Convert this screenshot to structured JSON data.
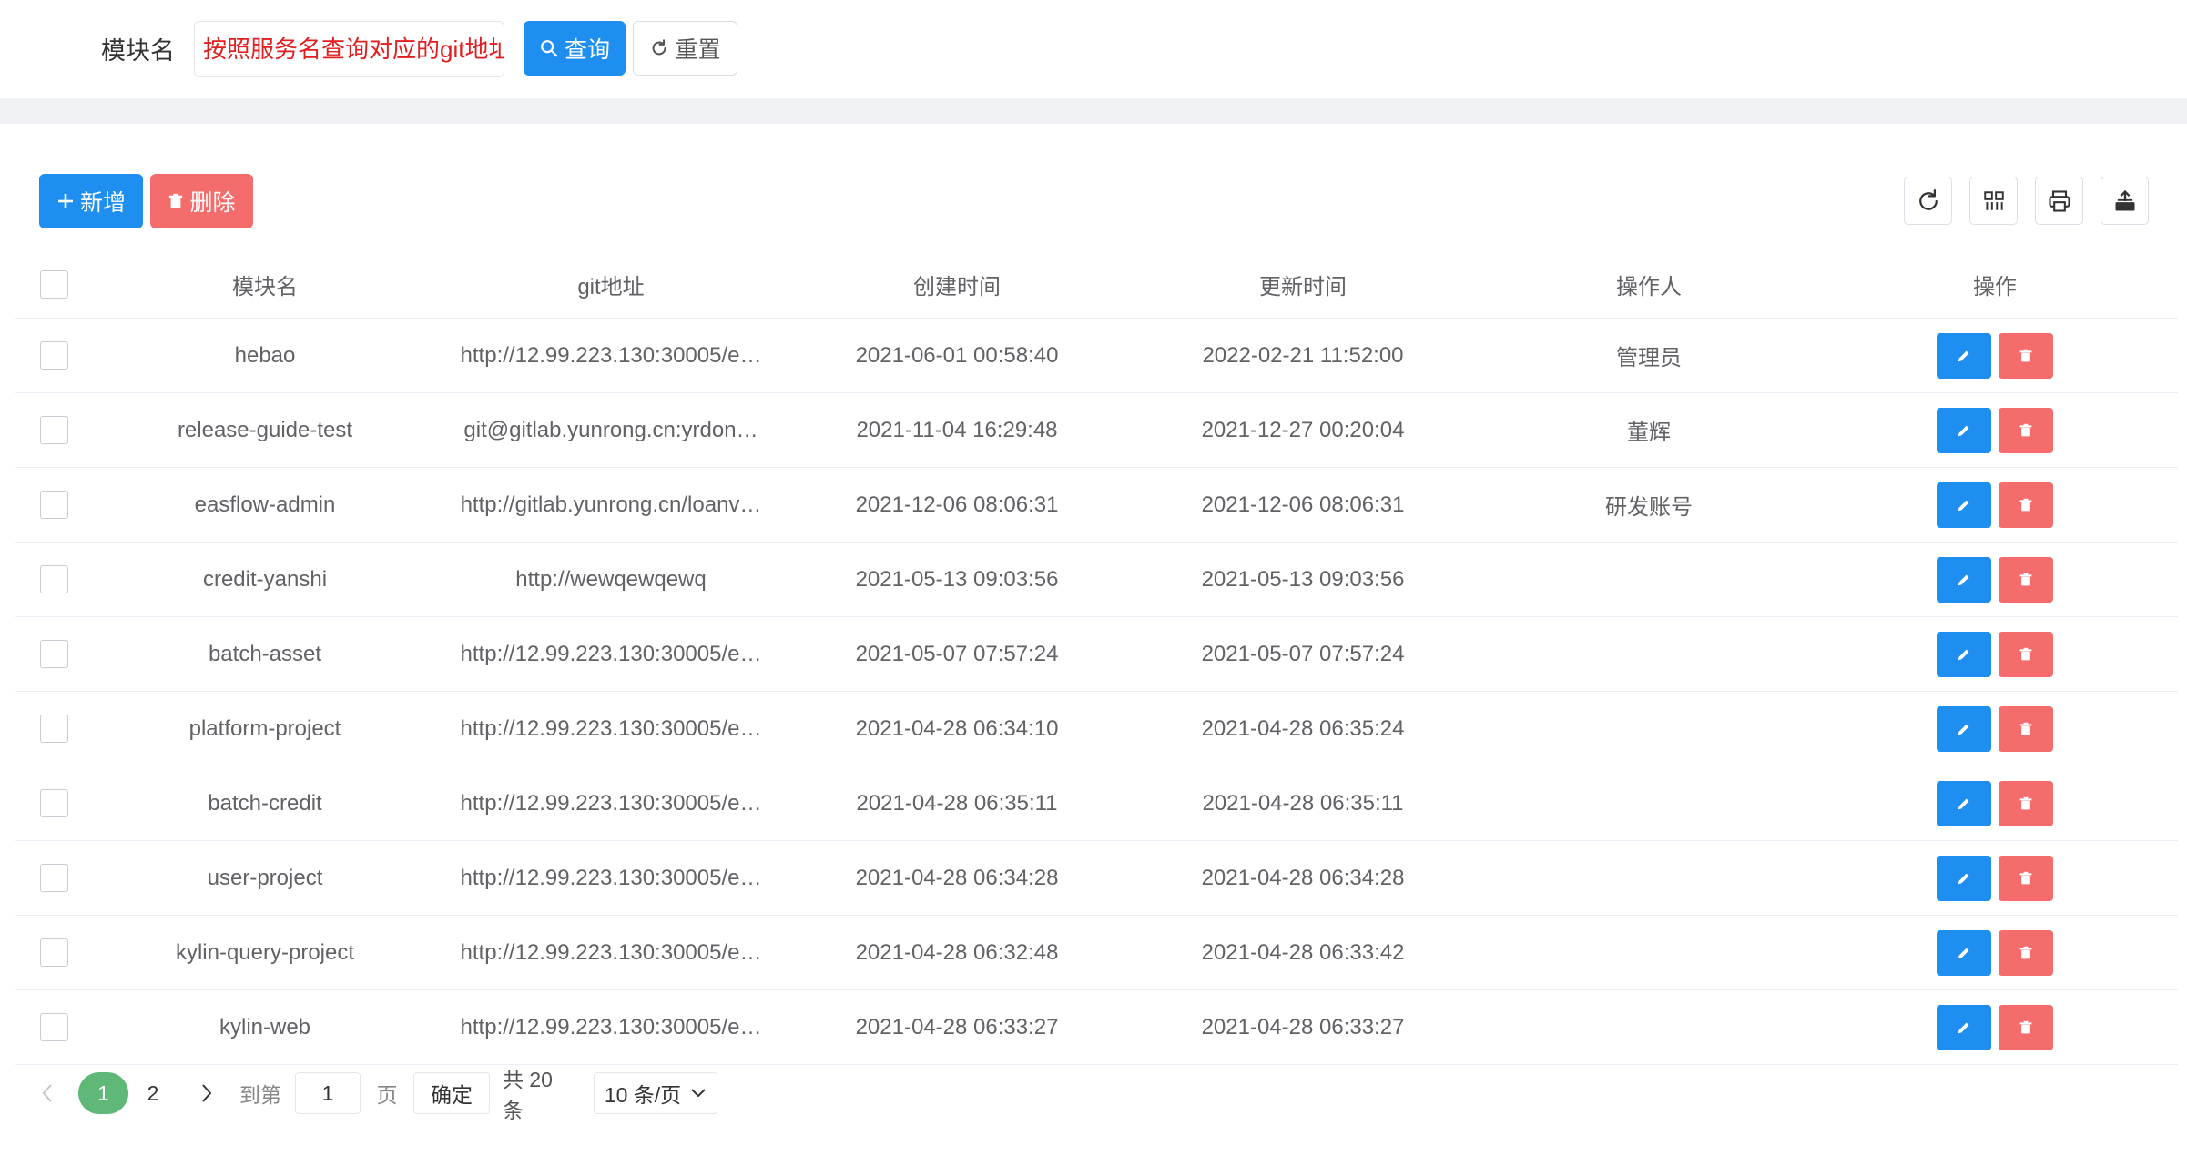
{
  "search": {
    "label": "模块名",
    "placeholder": "按照服务名查询对应的git地址",
    "query_label": "查询",
    "reset_label": "重置"
  },
  "toolbar": {
    "add_label": "新增",
    "delete_label": "删除",
    "tools": [
      "refresh-icon",
      "columns-icon",
      "print-icon",
      "export-icon"
    ]
  },
  "table": {
    "headers": {
      "name": "模块名",
      "git": "git地址",
      "created": "创建时间",
      "updated": "更新时间",
      "operator": "操作人",
      "actions": "操作"
    },
    "rows": [
      {
        "name": "hebao",
        "git": "http://12.99.223.130:30005/e…",
        "created": "2021-06-01 00:58:40",
        "updated": "2022-02-21 11:52:00",
        "operator": "管理员"
      },
      {
        "name": "release-guide-test",
        "git": "git@gitlab.yunrong.cn:yrdon…",
        "created": "2021-11-04 16:29:48",
        "updated": "2021-12-27 00:20:04",
        "operator": "董辉"
      },
      {
        "name": "easflow-admin",
        "git": "http://gitlab.yunrong.cn/loanv…",
        "created": "2021-12-06 08:06:31",
        "updated": "2021-12-06 08:06:31",
        "operator": "研发账号"
      },
      {
        "name": "credit-yanshi",
        "git": "http://wewqewqewq",
        "created": "2021-05-13 09:03:56",
        "updated": "2021-05-13 09:03:56",
        "operator": ""
      },
      {
        "name": "batch-asset",
        "git": "http://12.99.223.130:30005/e…",
        "created": "2021-05-07 07:57:24",
        "updated": "2021-05-07 07:57:24",
        "operator": ""
      },
      {
        "name": "platform-project",
        "git": "http://12.99.223.130:30005/e…",
        "created": "2021-04-28 06:34:10",
        "updated": "2021-04-28 06:35:24",
        "operator": ""
      },
      {
        "name": "batch-credit",
        "git": "http://12.99.223.130:30005/e…",
        "created": "2021-04-28 06:35:11",
        "updated": "2021-04-28 06:35:11",
        "operator": ""
      },
      {
        "name": "user-project",
        "git": "http://12.99.223.130:30005/e…",
        "created": "2021-04-28 06:34:28",
        "updated": "2021-04-28 06:34:28",
        "operator": ""
      },
      {
        "name": "kylin-query-project",
        "git": "http://12.99.223.130:30005/e…",
        "created": "2021-04-28 06:32:48",
        "updated": "2021-04-28 06:33:42",
        "operator": ""
      },
      {
        "name": "kylin-web",
        "git": "http://12.99.223.130:30005/e…",
        "created": "2021-04-28 06:33:27",
        "updated": "2021-04-28 06:33:27",
        "operator": ""
      }
    ]
  },
  "pagination": {
    "pages": [
      "1",
      "2"
    ],
    "current": "1",
    "goto_label": "到第",
    "goto_value": "1",
    "page_word": "页",
    "confirm_label": "确定",
    "total_label": "共 20 条",
    "page_size_label": "10 条/页"
  },
  "colors": {
    "primary": "#1e8ef0",
    "danger": "#f56c6c",
    "pager_active": "#5fb878",
    "placeholder_red": "#e02020"
  }
}
